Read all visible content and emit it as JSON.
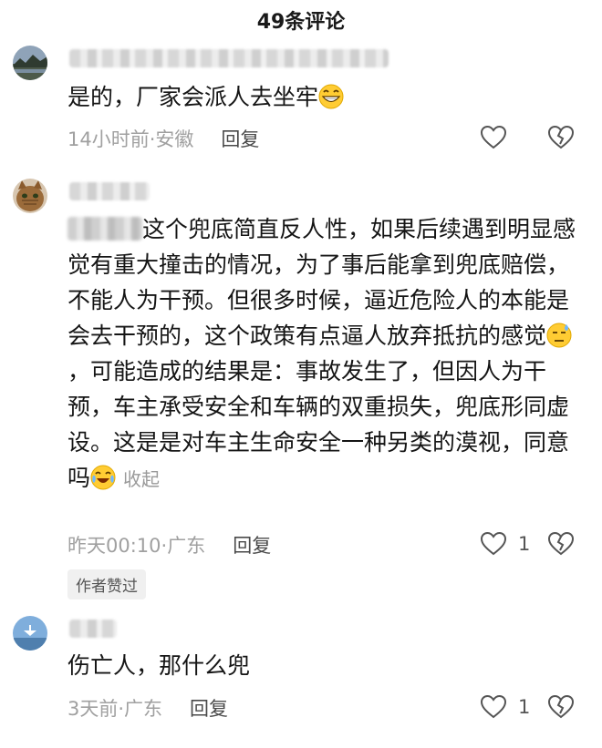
{
  "header": {
    "title": "49条评论"
  },
  "comments": [
    {
      "text": "是的，厂家会派人去坐牢",
      "time_location": "14小时前·安徽",
      "reply_label": "回复",
      "likes": ""
    },
    {
      "text": "这个兜底简直反人性，如果后续遇到明显感觉有重大撞击的情况，为了事后能拿到兜底赔偿，不能人为干预。但很多时候，逼近危险人的本能是会去干预的，这个政策有点逼人放弃抵抗的感觉",
      "text_cont": "，可能造成的结果是：事故发生了，但因人为干预，车主承受安全和车辆的双重损失，兜底形同虚设。这是是对车主生命安全一种另类的漠视，同意吗",
      "collapse_label": "收起",
      "time_location": "昨天00:10·广东",
      "reply_label": "回复",
      "likes": "1",
      "badge": "作者赞过"
    },
    {
      "text": "伤亡人，那什么兜",
      "time_location": "3天前·广东",
      "reply_label": "回复",
      "likes": "1"
    }
  ],
  "icons": {
    "like": "heart-outline-icon",
    "dislike": "broken-heart-icon",
    "emoji_grin": "grinning-emoji",
    "emoji_sweat": "sweat-emoji",
    "emoji_cry": "crying-laughing-emoji"
  },
  "colors": {
    "meta_text": "#a0a0a0",
    "body_text": "#151515",
    "badge_bg": "#f0f0f0"
  }
}
